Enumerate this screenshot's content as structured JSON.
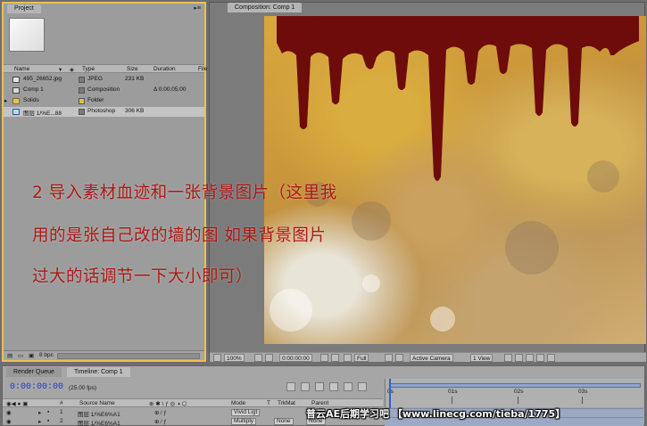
{
  "project_panel": {
    "tab_label": "Project",
    "columns": [
      "Name",
      "Type",
      "Size",
      "Duration",
      "File"
    ],
    "items": [
      {
        "name": "495_26652.jpg",
        "type": "JPEG",
        "size": "231 KB",
        "duration": "",
        "icon": "image-file-icon"
      },
      {
        "name": "Comp 1",
        "type": "Composition",
        "size": "",
        "duration": "Δ 0:00:05:00",
        "icon": "composition-icon"
      },
      {
        "name": "Solids",
        "type": "Folder",
        "size": "",
        "duration": "",
        "icon": "folder-icon"
      },
      {
        "name": "图层 1/%E...88",
        "type": "Photoshop",
        "size": "306 KB",
        "duration": "",
        "icon": "photoshop-file-icon"
      }
    ],
    "bpc": "8 bpc"
  },
  "composition_panel": {
    "tab_label": "Composition: Comp 1",
    "controls": {
      "zoom": "100%",
      "timecode": "0:00:00:00",
      "resolution": "Full",
      "camera": "Active Camera",
      "view": "1 View"
    }
  },
  "caption_lines": [
    "2 导入素材血迹和一张背景图片（这里我",
    "用的是张自己改的墙的图 如果背景图片",
    "过大的话调节一下大小即可）"
  ],
  "timeline": {
    "tabs": [
      "Render Queue",
      "Timeline: Comp 1"
    ],
    "timecode": "0:00:00:00",
    "fps": "(25.00 fps)",
    "columns": [
      "#",
      "Source Name",
      "Mode",
      "T",
      "TrkMat",
      "Parent"
    ],
    "ruler_labels": [
      "0s",
      "01s",
      "02s",
      "03s"
    ],
    "layers": [
      {
        "num": "1",
        "source": "图层 1/%E6%A1",
        "mode": "Vivid Ligt",
        "trkmat": "",
        "parent": "None"
      },
      {
        "num": "2",
        "source": "图层 1/%E6%A1",
        "mode": "Multiply",
        "trkmat": "None",
        "parent": "None"
      }
    ]
  },
  "watermark": "普云AE后期学习吧 【www.linecg.com/tieba/1775】",
  "colors": {
    "panel_gray": "#9c9c9c",
    "highlight_border": "#e8c24f",
    "caption_red": "#ad1714",
    "timecode_blue": "#1d3fb0",
    "blood": "#6e0b0b"
  }
}
